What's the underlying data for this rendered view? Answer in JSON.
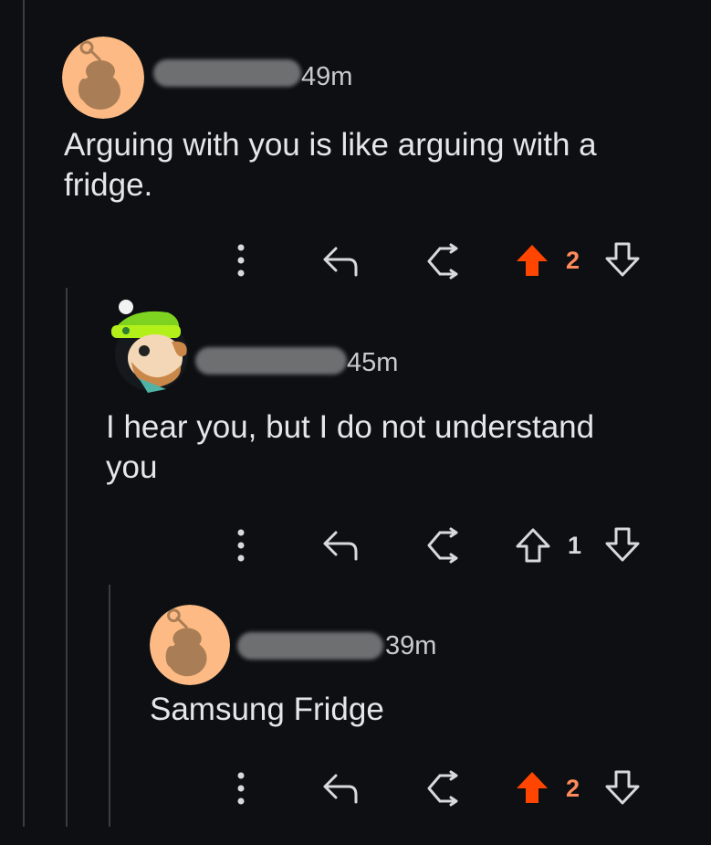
{
  "colors": {
    "background": "#0d0f12",
    "text": "#e4e6e8",
    "muted": "#c8cacc",
    "upvote_active": "#ff4500",
    "icon": "#d7dadc",
    "thread_line": "#3a3d40",
    "avatar_orange": "#fdba84",
    "snoo_brown": "#a97d55"
  },
  "comments": [
    {
      "timestamp": "49m",
      "body": "Arguing with you is like arguing with a fridge.",
      "score": "2",
      "upvoted": true,
      "avatar": "default-snoo-avatar"
    },
    {
      "timestamp": "45m",
      "body": "I hear you, but I do not understand you",
      "score": "1",
      "upvoted": false,
      "avatar": "custom-beanie-avatar"
    },
    {
      "timestamp": "39m",
      "body": "Samsung Fridge",
      "score": "2",
      "upvoted": true,
      "avatar": "default-snoo-avatar"
    }
  ],
  "icons": {
    "more": "more-options-icon",
    "reply": "reply-icon",
    "share": "share-icon",
    "upvote": "upvote-arrow-icon",
    "downvote": "downvote-arrow-icon"
  }
}
